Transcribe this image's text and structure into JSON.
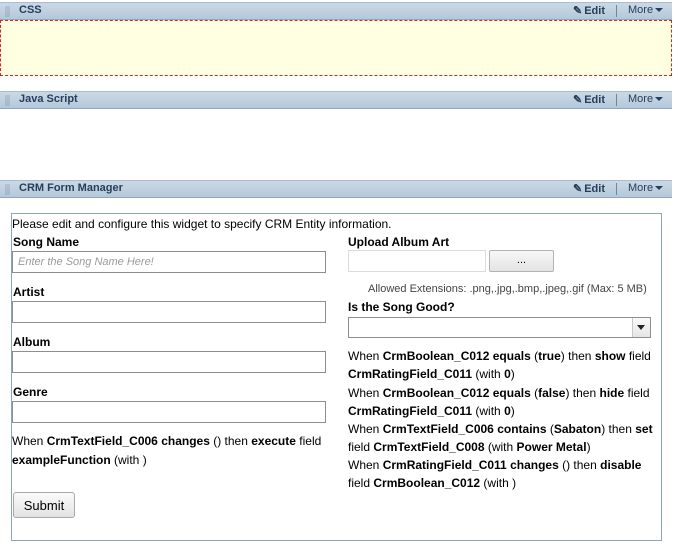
{
  "widgets": {
    "css": {
      "title": "CSS",
      "edit": "Edit",
      "more": "More"
    },
    "js": {
      "title": "Java Script",
      "edit": "Edit",
      "more": "More"
    },
    "crm": {
      "title": "CRM Form Manager",
      "edit": "Edit",
      "more": "More"
    }
  },
  "form": {
    "intro": "Please edit and configure this widget to specify CRM Entity information.",
    "song_name_label": "Song Name",
    "song_name_placeholder": "Enter the Song Name Here!",
    "artist_label": "Artist",
    "album_label": "Album",
    "genre_label": "Genre",
    "upload_label": "Upload Album Art",
    "browse_label": "...",
    "allowed_ext": "Allowed Extensions: .png,.jpg,.bmp,.jpeg,.gif (Max: 5 MB)",
    "good_label": "Is the Song Good?",
    "submit_label": "Submit",
    "left_rule": [
      {
        "t": "When ",
        "b": false
      },
      {
        "t": "CrmTextField_C006",
        "b": true
      },
      {
        "t": " ",
        "b": false
      },
      {
        "t": "changes",
        "b": true
      },
      {
        "t": " () then ",
        "b": false
      },
      {
        "t": "execute",
        "b": true
      },
      {
        "t": " field",
        "b": false
      }
    ],
    "left_rule_2": [
      {
        "t": "exampleFunction",
        "b": true
      },
      {
        "t": " (with )",
        "b": false
      }
    ],
    "right_rules": [
      [
        {
          "t": "When ",
          "b": false
        },
        {
          "t": "CrmBoolean_C012",
          "b": true
        },
        {
          "t": " ",
          "b": false
        },
        {
          "t": "equals",
          "b": true
        },
        {
          "t": " (",
          "b": false
        },
        {
          "t": "true",
          "b": true
        },
        {
          "t": ") then ",
          "b": false
        },
        {
          "t": "show",
          "b": true
        },
        {
          "t": " field",
          "b": false
        }
      ],
      [
        {
          "t": "CrmRatingField_C011",
          "b": true
        },
        {
          "t": " (with ",
          "b": false
        },
        {
          "t": "0",
          "b": true
        },
        {
          "t": ")",
          "b": false
        }
      ],
      [
        {
          "t": "When ",
          "b": false
        },
        {
          "t": "CrmBoolean_C012",
          "b": true
        },
        {
          "t": " ",
          "b": false
        },
        {
          "t": "equals",
          "b": true
        },
        {
          "t": " (",
          "b": false
        },
        {
          "t": "false",
          "b": true
        },
        {
          "t": ") then ",
          "b": false
        },
        {
          "t": "hide",
          "b": true
        },
        {
          "t": " field",
          "b": false
        }
      ],
      [
        {
          "t": "CrmRatingField_C011",
          "b": true
        },
        {
          "t": " (with ",
          "b": false
        },
        {
          "t": "0",
          "b": true
        },
        {
          "t": ")",
          "b": false
        }
      ],
      [
        {
          "t": "When ",
          "b": false
        },
        {
          "t": "CrmTextField_C006",
          "b": true
        },
        {
          "t": " ",
          "b": false
        },
        {
          "t": "contains",
          "b": true
        },
        {
          "t": " (",
          "b": false
        },
        {
          "t": "Sabaton",
          "b": true
        },
        {
          "t": ") then ",
          "b": false
        },
        {
          "t": "set",
          "b": true
        }
      ],
      [
        {
          "t": "field ",
          "b": false
        },
        {
          "t": "CrmTextField_C008",
          "b": true
        },
        {
          "t": " (with ",
          "b": false
        },
        {
          "t": "Power Metal",
          "b": true
        },
        {
          "t": ")",
          "b": false
        }
      ],
      [
        {
          "t": "When ",
          "b": false
        },
        {
          "t": "CrmRatingField_C011",
          "b": true
        },
        {
          "t": " ",
          "b": false
        },
        {
          "t": "changes",
          "b": true
        },
        {
          "t": " () then ",
          "b": false
        },
        {
          "t": "disable",
          "b": true
        }
      ],
      [
        {
          "t": "field ",
          "b": false
        },
        {
          "t": "CrmBoolean_C012",
          "b": true
        },
        {
          "t": " (with )",
          "b": false
        }
      ]
    ]
  },
  "colors": {
    "css_area_bg": "#ffffe1",
    "css_area_border": "#d9242b",
    "bar_bg": "#b4c8d9"
  }
}
